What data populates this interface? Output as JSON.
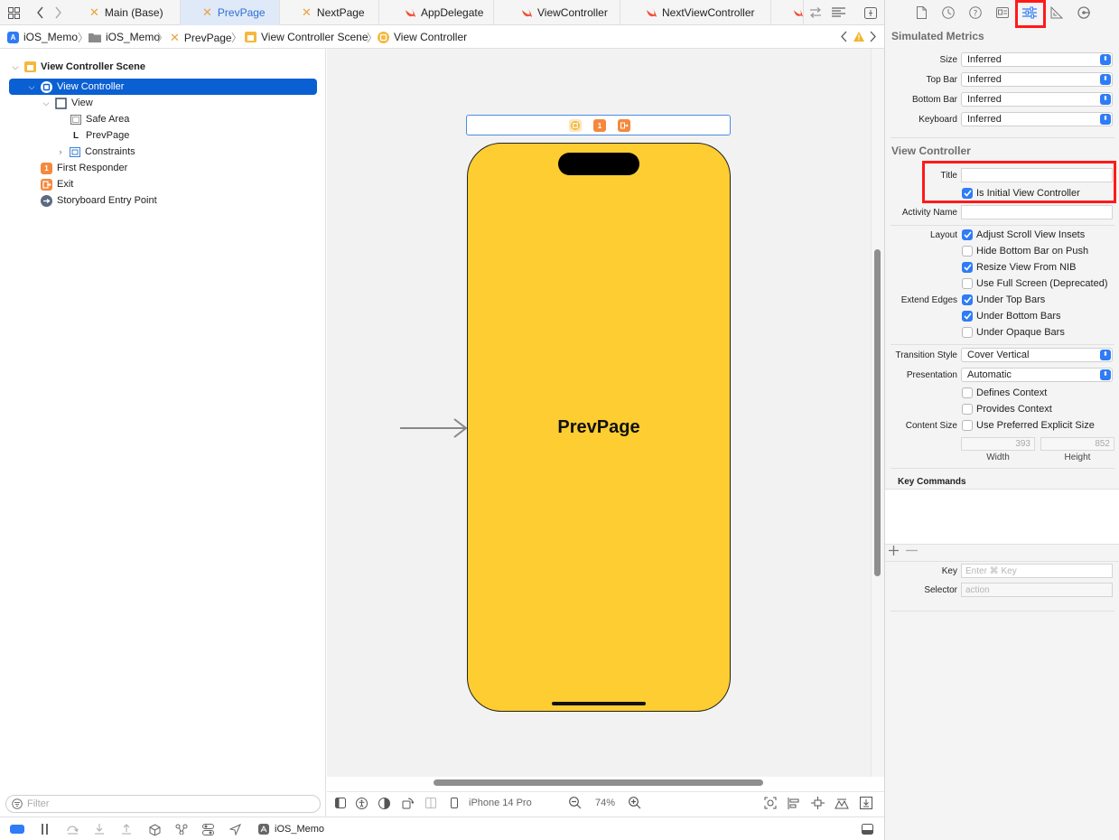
{
  "tabs": [
    {
      "label": "Main (Base)",
      "kind": "ib"
    },
    {
      "label": "PrevPage",
      "kind": "ib",
      "active": true
    },
    {
      "label": "NextPage",
      "kind": "ib"
    },
    {
      "label": "AppDelegate",
      "kind": "swift"
    },
    {
      "label": "ViewController",
      "kind": "swift"
    },
    {
      "label": "NextViewController",
      "kind": "swift"
    }
  ],
  "breadcrumb": [
    "iOS_Memo",
    "iOS_Memo",
    "PrevPage",
    "View Controller Scene",
    "View Controller"
  ],
  "navigator": {
    "scene": "View Controller Scene",
    "items": [
      "View Controller",
      "View",
      "Safe Area",
      "PrevPage",
      "Constraints",
      "First Responder",
      "Exit",
      "Storyboard Entry Point"
    ],
    "prevpage_glyph": "L",
    "first_responder_glyph": "1",
    "filter_placeholder": "Filter"
  },
  "canvas": {
    "phone_label": "PrevPage",
    "phone_color": "#fdcd31",
    "scene_badge": "1"
  },
  "canvas_bar": {
    "device": "iPhone 14 Pro",
    "zoom": "74%"
  },
  "debug_bar": {
    "scheme": "iOS_Memo"
  },
  "inspector": {
    "simulated_metrics": {
      "title": "Simulated Metrics",
      "rows": [
        {
          "label": "Size",
          "value": "Inferred"
        },
        {
          "label": "Top Bar",
          "value": "Inferred"
        },
        {
          "label": "Bottom Bar",
          "value": "Inferred"
        },
        {
          "label": "Keyboard",
          "value": "Inferred"
        }
      ]
    },
    "view_controller": {
      "title": "View Controller",
      "title_label": "Title",
      "title_value": "",
      "initial": {
        "label": "Is Initial View Controller",
        "checked": true
      },
      "activity_label": "Activity Name",
      "activity_value": "",
      "layout_label": "Layout",
      "layout": [
        {
          "label": "Adjust Scroll View Insets",
          "checked": true
        },
        {
          "label": "Hide Bottom Bar on Push",
          "checked": false
        },
        {
          "label": "Resize View From NIB",
          "checked": true
        },
        {
          "label": "Use Full Screen (Deprecated)",
          "checked": false
        }
      ],
      "extend_label": "Extend Edges",
      "extend": [
        {
          "label": "Under Top Bars",
          "checked": true
        },
        {
          "label": "Under Bottom Bars",
          "checked": true
        },
        {
          "label": "Under Opaque Bars",
          "checked": false
        }
      ],
      "transition_label": "Transition Style",
      "transition_value": "Cover Vertical",
      "presentation_label": "Presentation",
      "presentation_value": "Automatic",
      "context": [
        {
          "label": "Defines Context",
          "checked": false
        },
        {
          "label": "Provides Context",
          "checked": false
        }
      ],
      "content_size_label": "Content Size",
      "content_size": {
        "label": "Use Preferred Explicit Size",
        "checked": false
      },
      "width": "393",
      "height": "852",
      "width_label": "Width",
      "height_label": "Height"
    },
    "key_commands": {
      "title": "Key Commands",
      "key_label": "Key",
      "key_placeholder": "Enter ⌘ Key",
      "selector_label": "Selector",
      "selector_placeholder": "action"
    }
  }
}
